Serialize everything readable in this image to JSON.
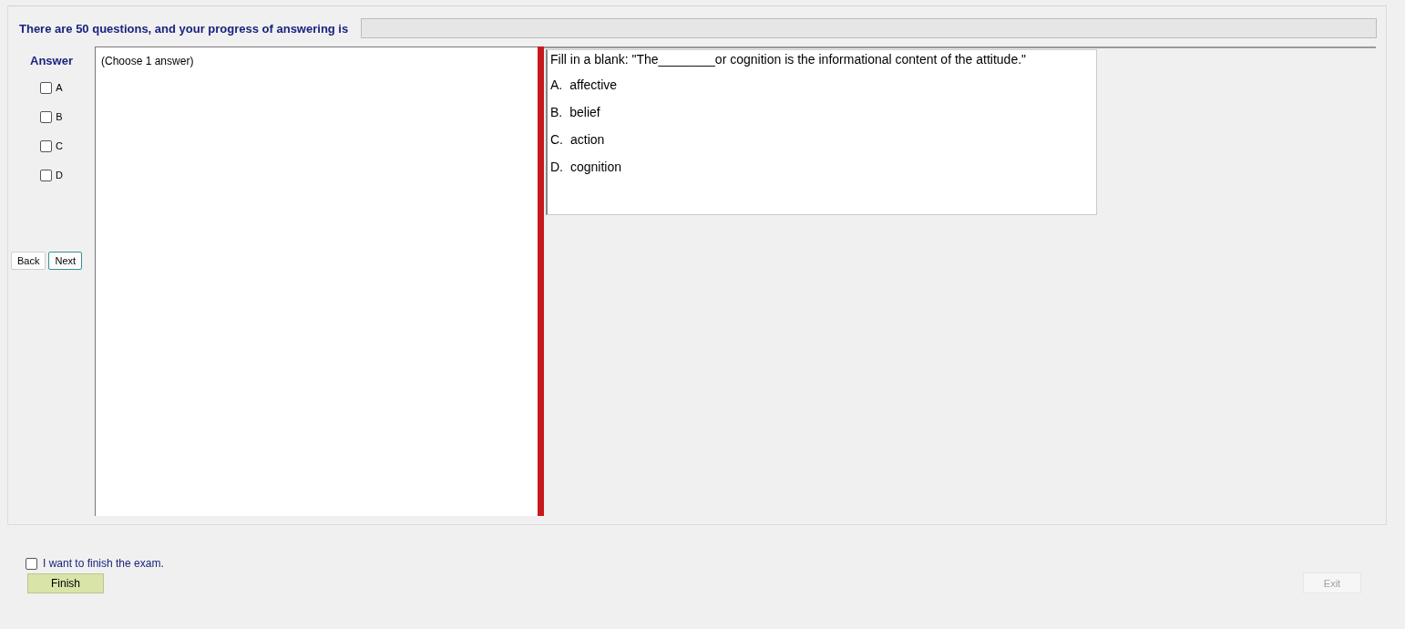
{
  "header": {
    "text": "There are 50 questions, and your progress of answering is",
    "progress": {
      "level": 0
    }
  },
  "answer_panel": {
    "title": "Answer",
    "options": [
      {
        "label": "A",
        "checked": false
      },
      {
        "label": "B",
        "checked": false
      },
      {
        "label": "C",
        "checked": false
      },
      {
        "label": "D",
        "checked": false
      }
    ],
    "buttons": [
      {
        "label": "Back",
        "selected": false
      },
      {
        "label": "Next",
        "selected": true
      }
    ],
    "hint": "(Choose 1 answer)"
  },
  "question": {
    "stem": "Fill in a blank: \"The________or cognition is the informational content of the attitude.\"",
    "choices": [
      {
        "letter": "A.",
        "text": "affective"
      },
      {
        "letter": "B.",
        "text": "belief"
      },
      {
        "letter": "C.",
        "text": "action"
      },
      {
        "letter": "D.",
        "text": "cognition"
      }
    ]
  },
  "finish": {
    "label": "I want to finish the exam.",
    "checked": false,
    "button": "Finish"
  },
  "exit_button": {
    "label": "Exit",
    "disabled": true
  }
}
